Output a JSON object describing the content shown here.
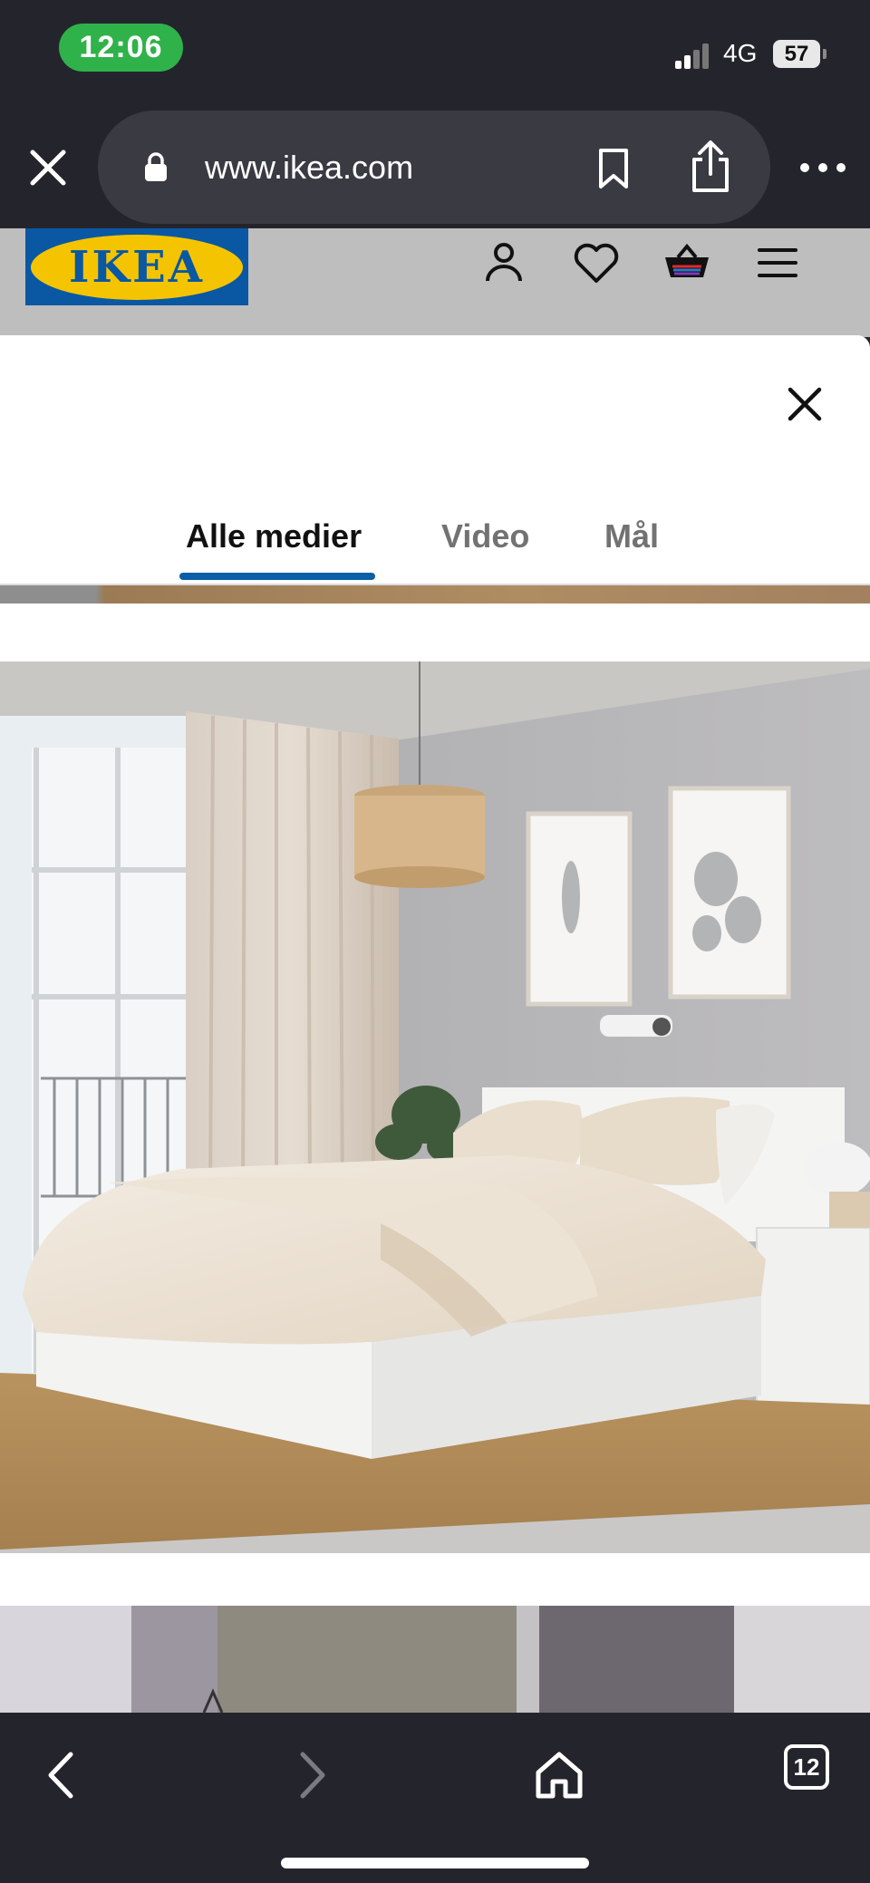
{
  "status_bar": {
    "time": "12:06",
    "network": "4G",
    "battery": "57"
  },
  "browser": {
    "url": "www.ikea.com",
    "open_tabs": "12"
  },
  "site": {
    "logo_text": "IKEA",
    "brand_blue": "#0a58a3",
    "brand_yellow": "#f5c400",
    "icons": [
      "person-icon",
      "heart-icon",
      "basket-icon",
      "menu-icon"
    ]
  },
  "modal": {
    "tabs": [
      {
        "label": "Alle medier",
        "active": true
      },
      {
        "label": "Video",
        "active": false
      },
      {
        "label": "Mål",
        "active": false
      }
    ],
    "accent": "#0a5fa8"
  }
}
